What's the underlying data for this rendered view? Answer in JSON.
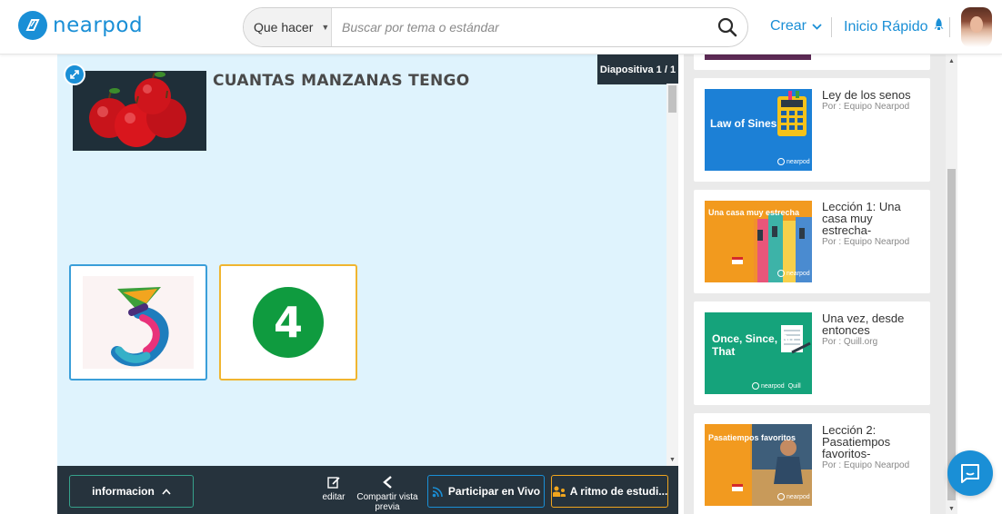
{
  "header": {
    "logo_text": "nearpod",
    "search": {
      "filter_label": "Que hacer",
      "placeholder": "Buscar por tema o estándar"
    },
    "nav": {
      "crear": "Crear",
      "inicio_rapido": "Inicio Rápido"
    }
  },
  "slide": {
    "counter": "Diapositiva 1 / 1",
    "title": "CUANTAS MANZANAS TENGO",
    "answers": [
      {
        "label": "3"
      },
      {
        "label": "4"
      }
    ]
  },
  "toolbar": {
    "info": "informacion",
    "edit": "editar",
    "share": "Compartir vista previa",
    "live": "Participar en Vivo",
    "student_paced": "A ritmo de estudi..."
  },
  "lessons": [
    {
      "title": "Ley de los senos",
      "author": "Por : Equipo Nearpod",
      "thumb_text": "Law of Sines",
      "thumb_color": "#1c80d6"
    },
    {
      "title": "Lección 1: Una casa muy estrecha-",
      "author": "Por : Equipo Nearpod",
      "thumb_text": "Una casa muy estrecha",
      "thumb_color": "#f29a1f"
    },
    {
      "title": "Una vez, desde entonces",
      "author": "Por : Quill.org",
      "thumb_text": "Once, Since, So That",
      "thumb_color": "#15a37b"
    },
    {
      "title": "Lección 2: Pasatiempos favoritos-",
      "author": "Por : Equipo Nearpod",
      "thumb_text": "Pasatiempos favoritos",
      "thumb_color": "#f29a1f"
    }
  ],
  "brand": {
    "mark": "nearpod",
    "partner": "Quill"
  },
  "colors": {
    "accent": "#1a8fd6",
    "slide_bg": "#dff3fd",
    "toolbar_bg": "#26333d",
    "answer_green": "#0f9b3f"
  }
}
